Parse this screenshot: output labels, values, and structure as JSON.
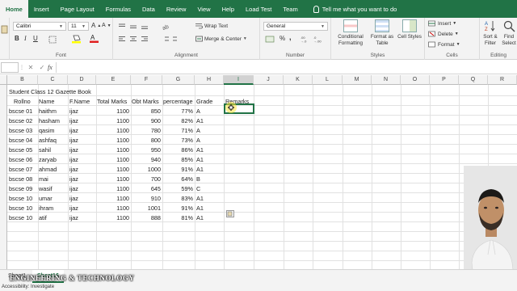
{
  "ribbon_tabs": [
    "Home",
    "Insert",
    "Page Layout",
    "Formulas",
    "Data",
    "Review",
    "View",
    "Help",
    "Load Test",
    "Team"
  ],
  "tell_me": "Tell me what you want to do",
  "ribbon": {
    "font_name": "Calibri",
    "font_size": "11",
    "bold_label": "B",
    "italic_label": "I",
    "underline_label": "U",
    "wrap_text": "Wrap Text",
    "merge_center": "Merge & Center",
    "number_format": "General",
    "percent": "%",
    "comma": ",",
    "conditional_formatting": "Conditional Formatting",
    "format_as_table": "Format as Table",
    "cell_styles": "Cell Styles",
    "insert": "Insert",
    "delete": "Delete",
    "format": "Format",
    "sort_filter": "Sort & Filter",
    "find_select": "Find Select",
    "groups": {
      "font": "Font",
      "alignment": "Alignment",
      "number": "Number",
      "styles": "Styles",
      "cells": "Cells",
      "editing": "Editing"
    }
  },
  "formula_bar": {
    "cancel": "✕",
    "enter": "✓",
    "fx": "fx",
    "content": ""
  },
  "columns": [
    "B",
    "C",
    "D",
    "E",
    "F",
    "G",
    "H",
    "I",
    "J",
    "K",
    "L",
    "M",
    "N",
    "O",
    "P",
    "Q",
    "R"
  ],
  "selected_column": "I",
  "sheet": {
    "title": "Student Class 12 Gazette Book",
    "headers": {
      "rollno": "Rollno",
      "name": "Name",
      "fname": "F.Name",
      "total": "Total Marks",
      "obt": "Obt Marks",
      "pct": "percentage",
      "grade": "Grade",
      "remarks": "Remarks"
    },
    "rows": [
      {
        "rollno": "bscse 01",
        "name": "haithm",
        "fname": "ijaz",
        "total": "1100",
        "obt": "850",
        "pct": "77%",
        "grade": "A"
      },
      {
        "rollno": "bscse 02",
        "name": "hasham",
        "fname": "ijaz",
        "total": "1100",
        "obt": "900",
        "pct": "82%",
        "grade": "A1"
      },
      {
        "rollno": "bscse 03",
        "name": "qasim",
        "fname": "ijaz",
        "total": "1100",
        "obt": "780",
        "pct": "71%",
        "grade": "A"
      },
      {
        "rollno": "bscse 04",
        "name": "ashfaq",
        "fname": "ijaz",
        "total": "1100",
        "obt": "800",
        "pct": "73%",
        "grade": "A"
      },
      {
        "rollno": "bscse 05",
        "name": "sahil",
        "fname": "ijaz",
        "total": "1100",
        "obt": "950",
        "pct": "86%",
        "grade": "A1"
      },
      {
        "rollno": "bscse 06",
        "name": "zaryab",
        "fname": "ijaz",
        "total": "1100",
        "obt": "940",
        "pct": "85%",
        "grade": "A1"
      },
      {
        "rollno": "bscse 07",
        "name": "ahmad",
        "fname": "ijaz",
        "total": "1100",
        "obt": "1000",
        "pct": "91%",
        "grade": "A1"
      },
      {
        "rollno": "bscse 08",
        "name": "mai",
        "fname": "ijaz",
        "total": "1100",
        "obt": "700",
        "pct": "64%",
        "grade": "B"
      },
      {
        "rollno": "bscse 09",
        "name": "wasif",
        "fname": "ijaz",
        "total": "1100",
        "obt": "645",
        "pct": "59%",
        "grade": "C"
      },
      {
        "rollno": "bscse 10",
        "name": "umar",
        "fname": "ijaz",
        "total": "1100",
        "obt": "910",
        "pct": "83%",
        "grade": "A1"
      },
      {
        "rollno": "bscse 10",
        "name": "ihram",
        "fname": "ijaz",
        "total": "1100",
        "obt": "1001",
        "pct": "91%",
        "grade": "A1"
      },
      {
        "rollno": "bscse 10",
        "name": "atif",
        "fname": "ijaz",
        "total": "1100",
        "obt": "888",
        "pct": "81%",
        "grade": "A1"
      }
    ]
  },
  "sheet_tabs": [
    "Sheet1",
    "Sheet16"
  ],
  "active_sheet": "Sheet16",
  "watermark": "ENGINEERING & TECHNOLOGY",
  "status_bar": "Accessibility: Investigate",
  "colors": {
    "excel_green": "#217346",
    "ribbon_bg": "#f3f3f3",
    "cursor_highlight": "#ffe63c"
  }
}
